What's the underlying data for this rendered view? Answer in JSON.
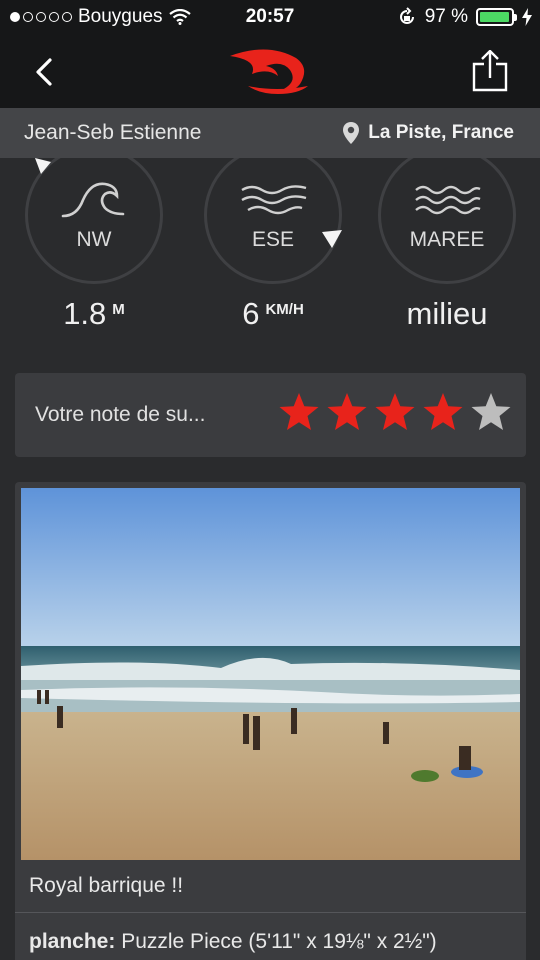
{
  "status_bar": {
    "carrier": "Bouygues",
    "time": "20:57",
    "battery": "97 %",
    "battery_level": 0.97,
    "signal_bars": 1,
    "icons": [
      "wifi-icon",
      "rotation-lock-icon",
      "charging-icon"
    ]
  },
  "nav": {
    "icons": [
      "back-chevron-icon",
      "rip-curl-wave-logo",
      "share-icon"
    ],
    "brand_color": "#e8231b"
  },
  "header": {
    "user_name": "Jean-Seb Estienne",
    "location": "La Piste, France"
  },
  "conditions": [
    {
      "icon": "wave-icon",
      "label": "NW",
      "value": "1.8",
      "unit": "M"
    },
    {
      "icon": "wind-icon",
      "label": "ESE",
      "value": "6",
      "unit": "KM/H"
    },
    {
      "icon": "tide-icon",
      "label": "MAREE",
      "value": "milieu",
      "unit": ""
    }
  ],
  "rating": {
    "label": "Votre note de su...",
    "stars_filled": 4,
    "stars_total": 5,
    "filled_color": "#e8231b",
    "empty_color": "#bdbdbd"
  },
  "post": {
    "caption": "Royal barrique !!",
    "board_label": "planche:",
    "board_value": " Puzzle Piece (5'11\" x 19⅛\" x 2½\")"
  }
}
